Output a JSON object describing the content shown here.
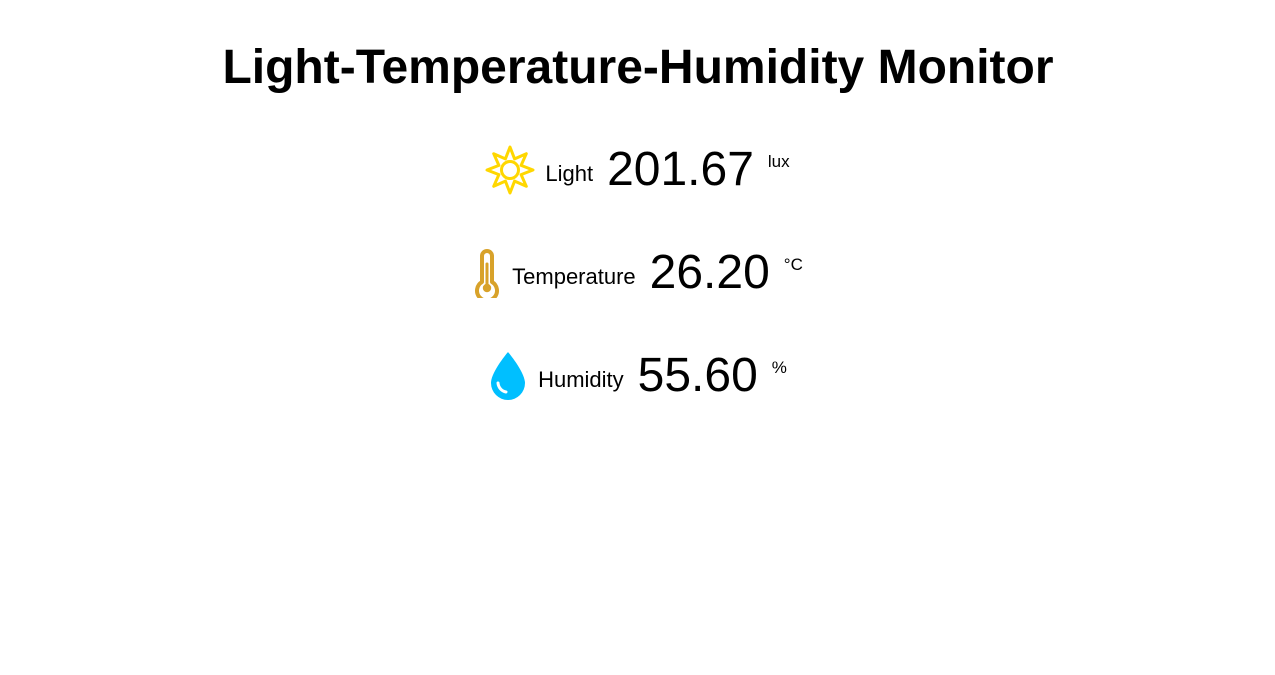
{
  "page": {
    "title": "Light-Temperature-Humidity Monitor"
  },
  "readings": {
    "light": {
      "icon": "sun-icon",
      "label": "Light",
      "value": "201.67",
      "unit": "lux",
      "color": "#FFD700"
    },
    "temperature": {
      "icon": "thermometer-icon",
      "label": "Temperature",
      "value": "26.20",
      "unit": "°C",
      "color": "#D8A22A"
    },
    "humidity": {
      "icon": "water-drop-icon",
      "label": "Humidity",
      "value": "55.60",
      "unit": "%",
      "color": "#00BFFF"
    }
  }
}
